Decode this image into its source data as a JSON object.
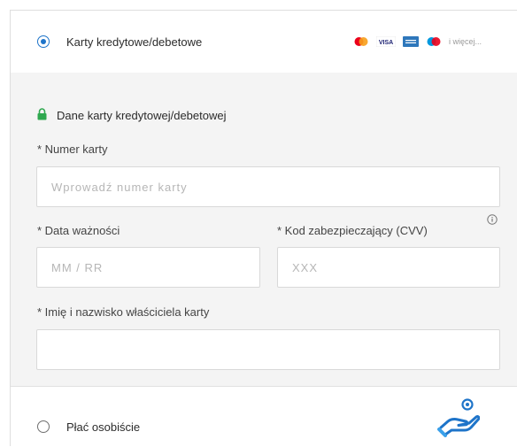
{
  "payment_options": {
    "card": {
      "label": "Karty kredytowe/debetowe",
      "selected": true,
      "brand_logos": [
        "mastercard-logo",
        "visa-logo",
        "amex-logo",
        "maestro-logo"
      ],
      "visa_text": "VISA",
      "more_label": "i więcej..."
    },
    "cash": {
      "label": "Płać osobiście",
      "selected": false
    }
  },
  "card_form": {
    "section_title": "Dane karty kredytowej/debetowej",
    "card_number": {
      "label": "* Numer karty",
      "placeholder": "Wprowadź numer karty",
      "value": ""
    },
    "expiry": {
      "label": "* Data ważności",
      "placeholder": "MM / RR",
      "value": ""
    },
    "cvv": {
      "label": "* Kod zabezpieczający (CVV)",
      "placeholder": "XXX",
      "value": ""
    },
    "holder_name": {
      "label": "* Imię i nazwisko właściciela karty",
      "placeholder": "",
      "value": ""
    }
  },
  "colors": {
    "accent": "#1e74c9",
    "lock": "#2fa84f",
    "panel_bg": "#f4f4f4"
  }
}
